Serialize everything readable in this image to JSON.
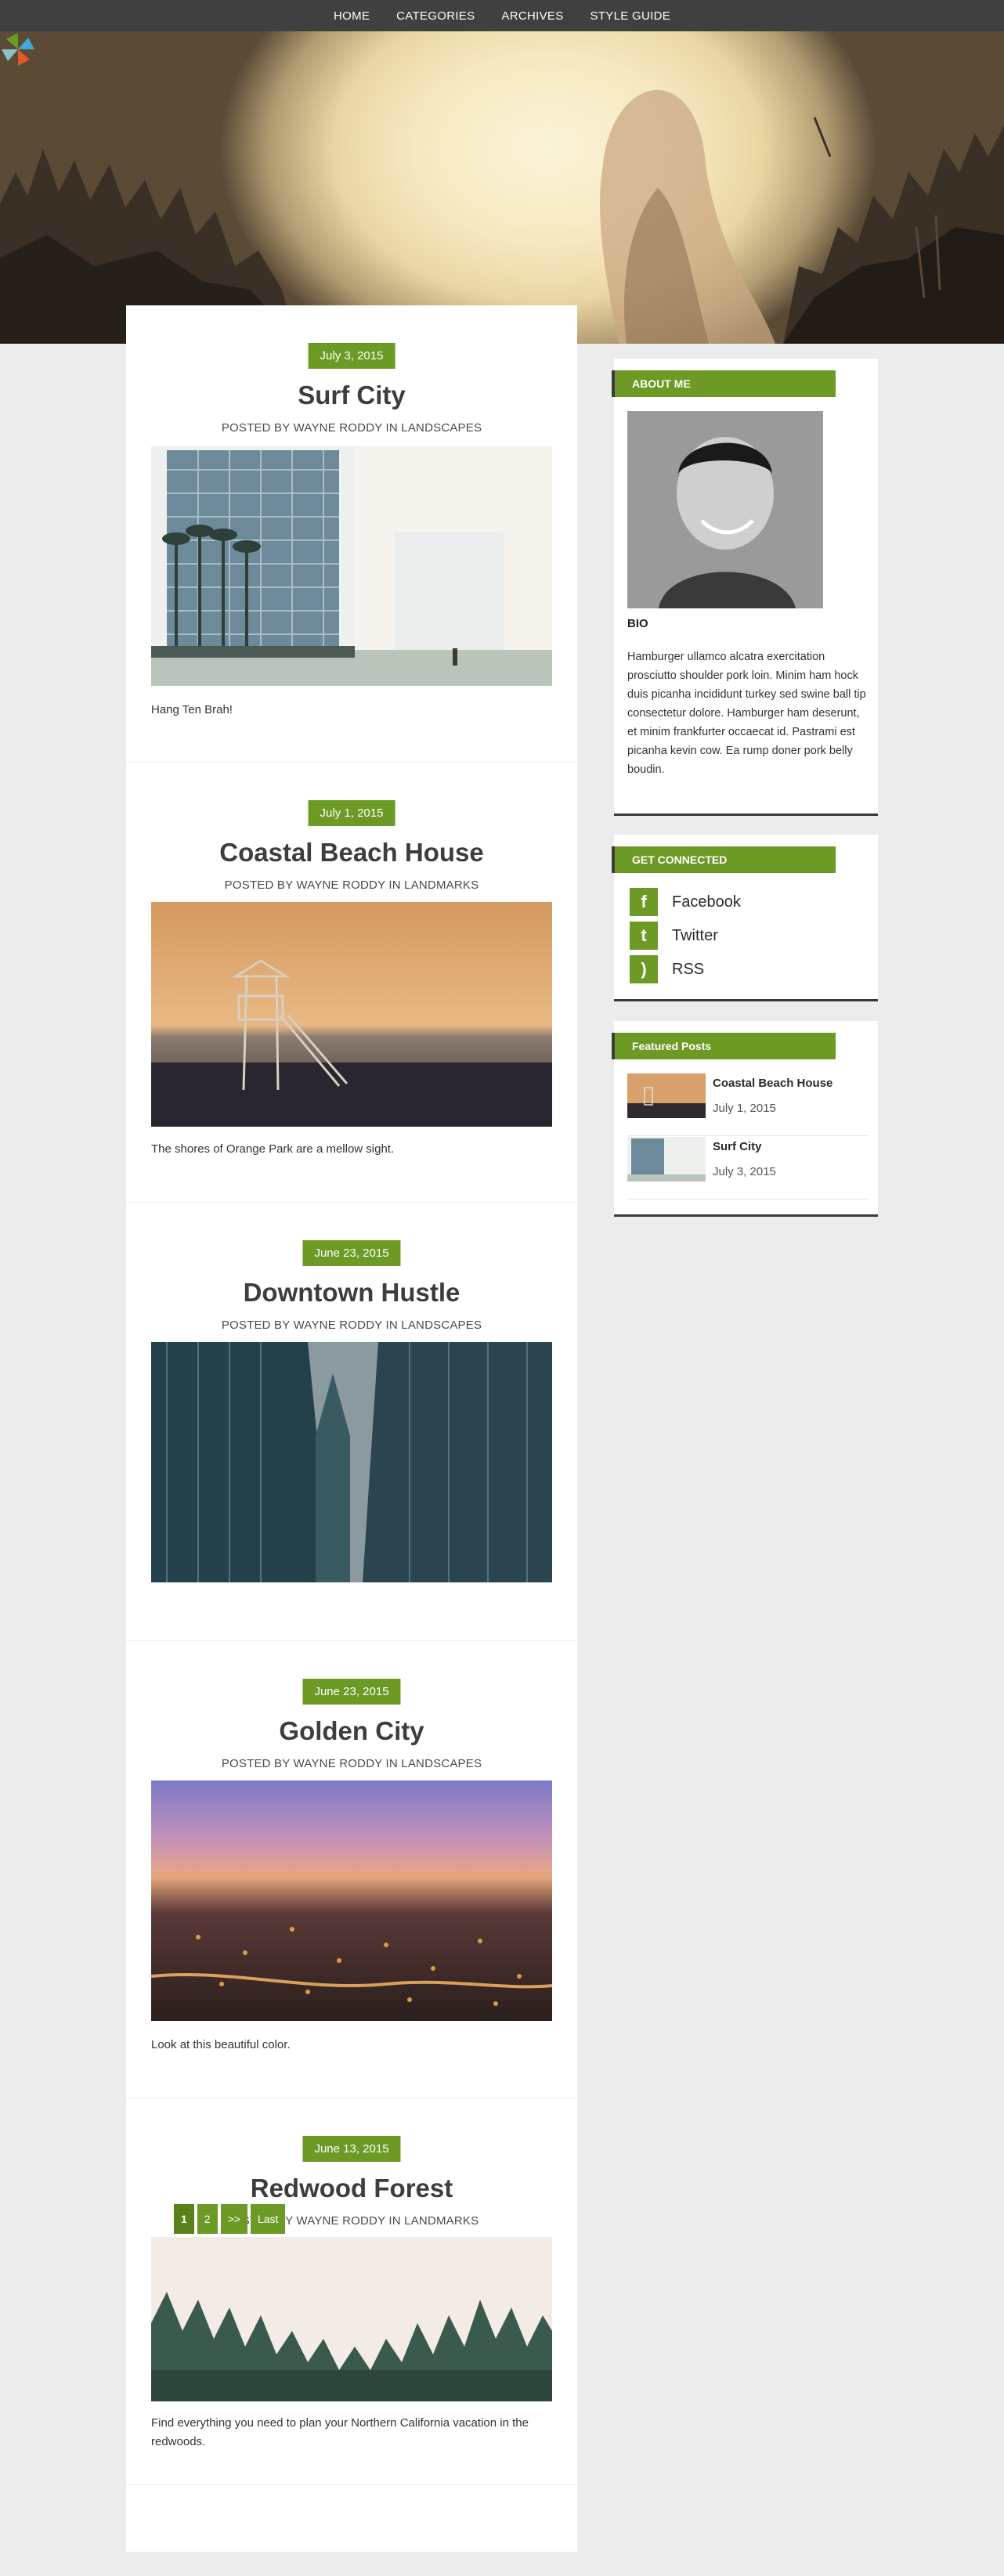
{
  "nav": {
    "items": [
      "HOME",
      "CATEGORIES",
      "ARCHIVES",
      "STYLE GUIDE"
    ]
  },
  "posts": [
    {
      "date": "July 3, 2015",
      "title": "Surf City",
      "meta": "POSTED BY WAYNE RODDY IN LANDSCAPES",
      "excerpt": "Hang Ten Brah!"
    },
    {
      "date": "July 1, 2015",
      "title": "Coastal Beach House",
      "meta": "POSTED BY WAYNE RODDY IN LANDMARKS",
      "excerpt": "The shores of Orange Park are a mellow sight."
    },
    {
      "date": "June 23, 2015",
      "title": "Downtown Hustle",
      "meta": "POSTED BY WAYNE RODDY IN LANDSCAPES",
      "excerpt": ""
    },
    {
      "date": "June 23, 2015",
      "title": "Golden City",
      "meta": "POSTED BY WAYNE RODDY IN LANDSCAPES",
      "excerpt": "Look at this beautiful color."
    },
    {
      "date": "June 13, 2015",
      "title": "Redwood Forest",
      "meta": "POSTED BY WAYNE RODDY IN LANDMARKS",
      "excerpt": "Find everything you need to plan your Northern California vacation in the redwoods."
    }
  ],
  "pagination": {
    "items": [
      "1",
      "2",
      ">>",
      "Last"
    ]
  },
  "sidebar": {
    "about": {
      "heading": "ABOUT ME",
      "bio_label": "BIO",
      "bio_text": "Hamburger ullamco alcatra exercitation prosciutto shoulder pork loin. Minim ham hock duis picanha incididunt turkey sed swine ball tip consectetur dolore. Hamburger ham deserunt, et minim frankfurter occaecat id. Pastrami est picanha kevin cow. Ea rump doner pork belly boudin."
    },
    "connect": {
      "heading": "GET CONNECTED",
      "links": [
        {
          "label": "Facebook",
          "icon": "facebook-icon",
          "glyph": "f"
        },
        {
          "label": "Twitter",
          "icon": "twitter-icon",
          "glyph": "t"
        },
        {
          "label": "RSS",
          "icon": "rss-icon",
          "glyph": ")"
        }
      ]
    },
    "featured": {
      "heading": "Featured Posts",
      "items": [
        {
          "title": "Coastal Beach House",
          "date": "July 1, 2015"
        },
        {
          "title": "Surf City",
          "date": "July 3, 2015"
        }
      ]
    }
  },
  "colors": {
    "accent": "#6d9a25",
    "nav_bg": "#404040",
    "page_bg": "#ececec"
  }
}
